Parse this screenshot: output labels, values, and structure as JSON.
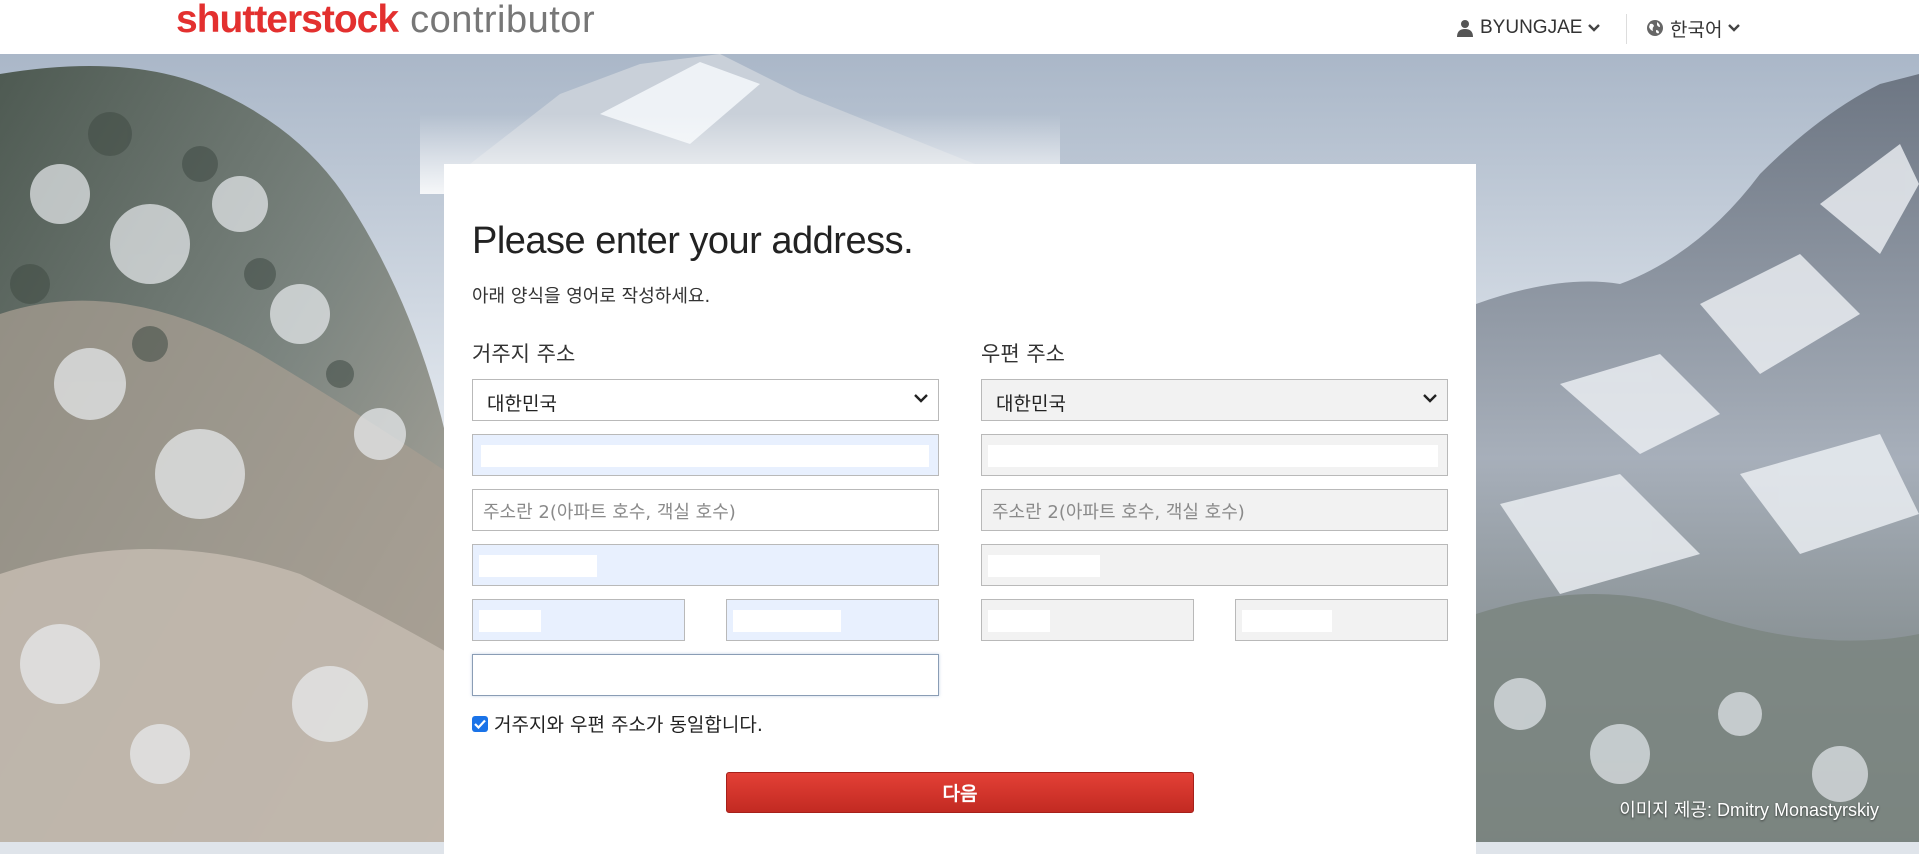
{
  "header": {
    "brand": "shutterstock",
    "brand_sub": "contributor",
    "user_label": "BYUNGJAE",
    "lang_label": "한국어"
  },
  "form": {
    "title": "Please enter your address.",
    "subtitle": "아래 양식을 영어로 작성하세요.",
    "residence": {
      "heading": "거주지 주소",
      "country": "대한민국",
      "address2_placeholder": "주소란 2(아파트 호수, 객실 호수)"
    },
    "mailing": {
      "heading": "우편 주소",
      "country": "대한민국",
      "address2_placeholder": "주소란 2(아파트 호수, 객실 호수)"
    },
    "same_address_label": "거주지와 우편 주소가 동일합니다.",
    "same_address_checked": true,
    "next_label": "다음"
  },
  "credit": "이미지 제공: Dmitry Monastyrskiy",
  "colors": {
    "brand": "#e3302f",
    "button": "#d0352c",
    "autofill": "#e8f0fe",
    "checkbox": "#1a73e8"
  }
}
